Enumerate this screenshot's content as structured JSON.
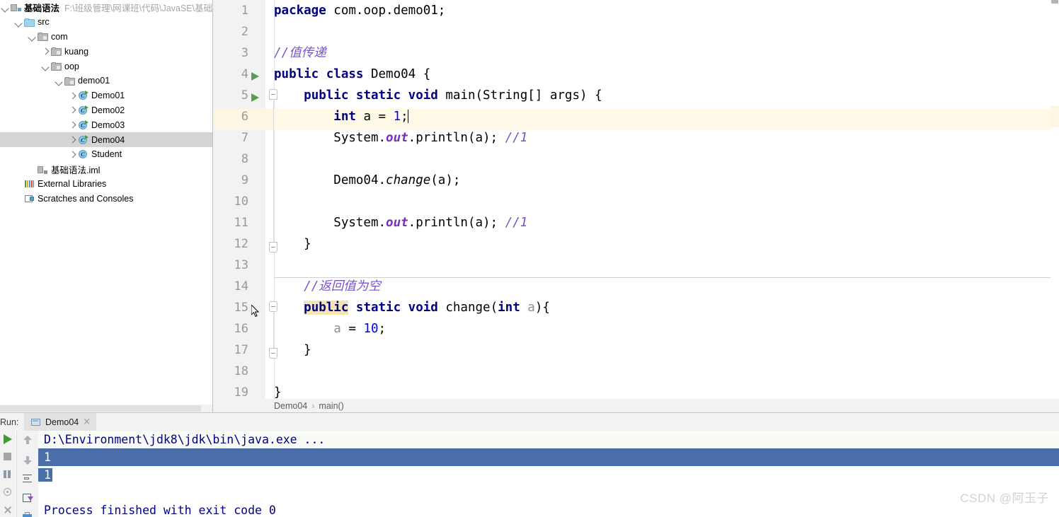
{
  "project": {
    "root": {
      "label": "基础语法",
      "path": "F:\\班级管理\\网课班\\代码\\JavaSE\\基础语"
    },
    "items": [
      {
        "label": "src",
        "icon": "folder-icon",
        "indent": 1,
        "arrow": "down",
        "selected": false
      },
      {
        "label": "com",
        "icon": "package-icon",
        "indent": 2,
        "arrow": "down",
        "selected": false
      },
      {
        "label": "kuang",
        "icon": "package-icon",
        "indent": 3,
        "arrow": "right",
        "selected": false
      },
      {
        "label": "oop",
        "icon": "package-icon",
        "indent": 3,
        "arrow": "down",
        "selected": false
      },
      {
        "label": "demo01",
        "icon": "package-icon",
        "indent": 4,
        "arrow": "down",
        "selected": false
      },
      {
        "label": "Demo01",
        "icon": "java-class-icon",
        "indent": 5,
        "arrow": "right",
        "selected": false
      },
      {
        "label": "Demo02",
        "icon": "java-class-icon",
        "indent": 5,
        "arrow": "right",
        "selected": false
      },
      {
        "label": "Demo03",
        "icon": "java-class-icon",
        "indent": 5,
        "arrow": "right",
        "selected": false
      },
      {
        "label": "Demo04",
        "icon": "java-class-icon",
        "indent": 5,
        "arrow": "right",
        "selected": true
      },
      {
        "label": "Student",
        "icon": "java-class-icon",
        "indent": 5,
        "arrow": "right",
        "selected": false
      },
      {
        "label": "基础语法.iml",
        "icon": "iml-file-icon",
        "indent": 2,
        "arrow": "none",
        "selected": false
      },
      {
        "label": "External Libraries",
        "icon": "libraries-icon",
        "indent": 1,
        "arrow": "none",
        "selected": false
      },
      {
        "label": "Scratches and Consoles",
        "icon": "scratches-icon",
        "indent": 1,
        "arrow": "none",
        "selected": false
      }
    ]
  },
  "editor": {
    "caret_line": 6,
    "lines": [
      {
        "n": "1",
        "code": "package com.oop.demo01;"
      },
      {
        "n": "2",
        "code": ""
      },
      {
        "n": "3",
        "code": "//值传递"
      },
      {
        "n": "4",
        "code": "public class Demo04 {"
      },
      {
        "n": "5",
        "code": "    public static void main(String[] args) {"
      },
      {
        "n": "6",
        "code": "        int a = 1;"
      },
      {
        "n": "7",
        "code": "        System.out.println(a); //1"
      },
      {
        "n": "8",
        "code": ""
      },
      {
        "n": "9",
        "code": "        Demo04.change(a);"
      },
      {
        "n": "10",
        "code": ""
      },
      {
        "n": "11",
        "code": "        System.out.println(a); //1"
      },
      {
        "n": "12",
        "code": "    }"
      },
      {
        "n": "13",
        "code": ""
      },
      {
        "n": "14",
        "code": "    //返回值为空"
      },
      {
        "n": "15",
        "code": "    public static void change(int a){"
      },
      {
        "n": "16",
        "code": "        a = 10;"
      },
      {
        "n": "17",
        "code": "    }"
      },
      {
        "n": "18",
        "code": ""
      },
      {
        "n": "19",
        "code": "}"
      }
    ],
    "breadcrumb": {
      "class": "Demo04",
      "separator": "›",
      "method": "main()"
    },
    "colors": {
      "keyword": "#000080",
      "number": "#0000ff",
      "comment": "#7a52cc",
      "static_field": "#7a2fb8",
      "parameter": "#909090",
      "caret_line_bg": "#fdf6e3",
      "identifier_highlight": "#f5e5b4"
    }
  },
  "run": {
    "label": "Run:",
    "tab": {
      "title": "Demo04",
      "close": "×"
    },
    "toolbar_left": [
      "rerun-icon",
      "stop-icon",
      "pause-icon",
      "trace-icon",
      "close-icon"
    ],
    "toolbar_right": [
      "scroll-up-icon",
      "scroll-down-icon",
      "soft-wrap-icon",
      "scroll-to-end-icon",
      "print-icon"
    ],
    "console": [
      {
        "text": "D:\\Environment\\jdk8\\jdk\\bin\\java.exe ...",
        "selection": "none"
      },
      {
        "text": "1",
        "selection": "full"
      },
      {
        "text": "1",
        "selection": "partial"
      },
      {
        "text": "",
        "selection": "none"
      },
      {
        "text": "Process finished with exit code 0",
        "selection": "none"
      }
    ],
    "colors": {
      "selection": "#4a6fa8",
      "text": "#000080"
    }
  },
  "watermark": "CSDN @阿玉子"
}
